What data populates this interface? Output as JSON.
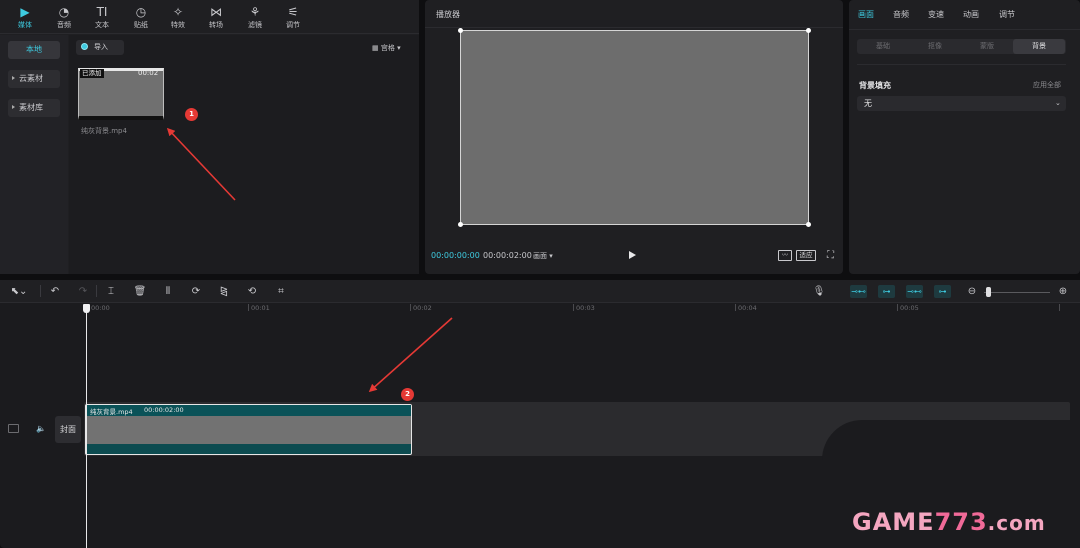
{
  "media_panel": {
    "tabs": [
      {
        "label": "媒体",
        "icon": "▶",
        "active": true
      },
      {
        "label": "音频",
        "icon": "◔"
      },
      {
        "label": "文本",
        "icon": "TI"
      },
      {
        "label": "贴纸",
        "icon": "◷"
      },
      {
        "label": "特效",
        "icon": "✧"
      },
      {
        "label": "转场",
        "icon": "⋈"
      },
      {
        "label": "滤镜",
        "icon": "⚘"
      },
      {
        "label": "调节",
        "icon": "⚟"
      }
    ],
    "side_items": [
      {
        "label": "本地",
        "active": true
      },
      {
        "label": "云素材"
      },
      {
        "label": "素材库"
      }
    ],
    "import_label": "导入",
    "sort_label": "宫格",
    "clip": {
      "badge": "已添加",
      "duration": "00:02",
      "name": "纯灰背景.mp4"
    }
  },
  "player": {
    "title": "播放器",
    "timecode_current": "00:00:00:00",
    "timecode_total": "00:00:02:00",
    "ratio_label": "画面",
    "adapt_label": "适应"
  },
  "inspector": {
    "tabs": [
      {
        "label": "画面",
        "active": true
      },
      {
        "label": "音频"
      },
      {
        "label": "变速"
      },
      {
        "label": "动画"
      },
      {
        "label": "调节"
      }
    ],
    "subtabs": [
      {
        "label": "基础"
      },
      {
        "label": "抠像"
      },
      {
        "label": "蒙版"
      },
      {
        "label": "背景",
        "active": true
      }
    ],
    "bg_fill_title": "背景填充",
    "apply_all": "应用全部",
    "fill_value": "无"
  },
  "timeline": {
    "ticks": [
      "00:00",
      "00:01",
      "00:02",
      "00:03",
      "00:04",
      "00:05"
    ],
    "clip_name": "纯灰背景.mp4",
    "clip_duration": "00:00:02:00",
    "cover_label": "封面"
  },
  "annotations": [
    "1",
    "2"
  ],
  "watermark": {
    "part1": "GAME",
    "part2": "773",
    "part3": ".com"
  },
  "colors": {
    "accent": "#3ecbe0",
    "annotation": "#e53935",
    "clip": "#0c4b50"
  }
}
